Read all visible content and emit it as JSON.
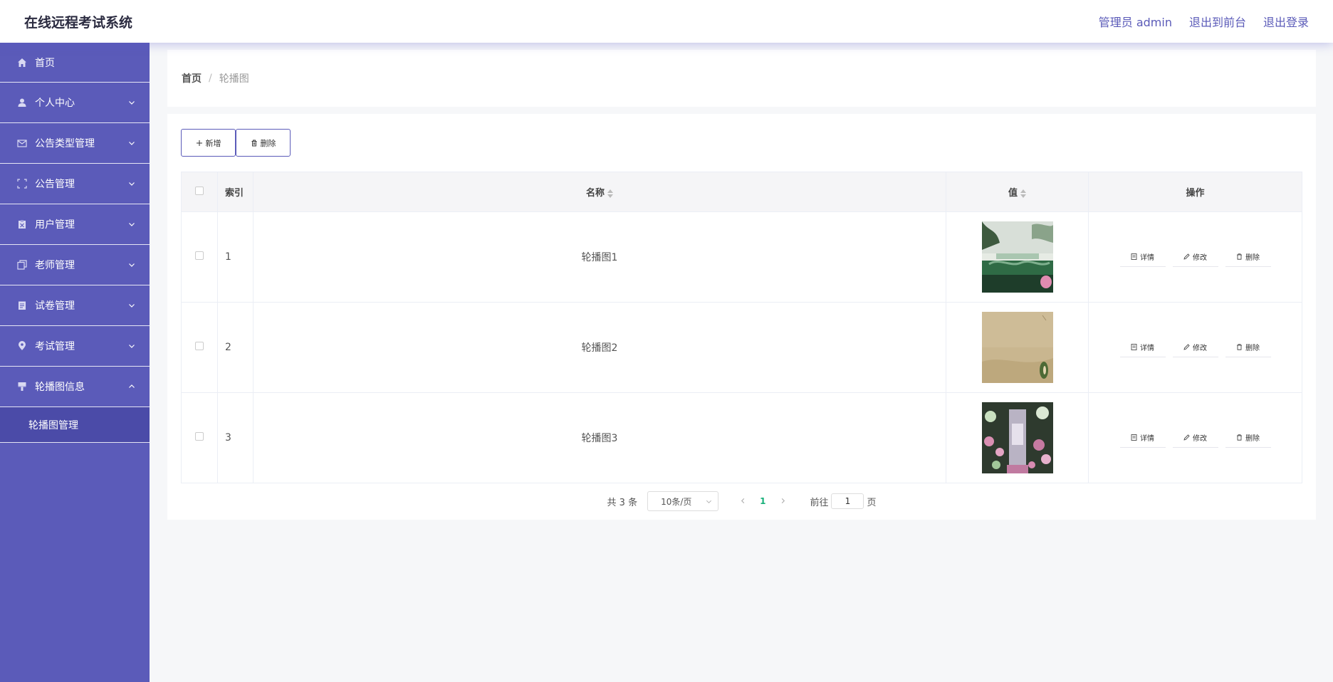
{
  "header": {
    "title": "在线远程考试系统",
    "user_label": "管理员 admin",
    "to_front": "退出到前台",
    "logout": "退出登录"
  },
  "sidebar": {
    "items": [
      {
        "label": "首页",
        "icon": "home-icon"
      },
      {
        "label": "个人中心",
        "icon": "user-icon"
      },
      {
        "label": "公告类型管理",
        "icon": "envelope-icon"
      },
      {
        "label": "公告管理",
        "icon": "fullscreen-icon"
      },
      {
        "label": "用户管理",
        "icon": "clipboard-icon"
      },
      {
        "label": "老师管理",
        "icon": "copy-icon"
      },
      {
        "label": "试卷管理",
        "icon": "document-icon"
      },
      {
        "label": "考试管理",
        "icon": "location-icon"
      },
      {
        "label": "轮播图信息",
        "icon": "brush-icon"
      }
    ],
    "submenu": {
      "label": "轮播图管理"
    }
  },
  "breadcrumb": {
    "home": "首页",
    "separator": "/",
    "current": "轮播图"
  },
  "toolbar": {
    "add_label": "新增",
    "delete_label": "删除"
  },
  "table": {
    "headers": {
      "index": "索引",
      "name": "名称",
      "value": "值",
      "actions": "操作"
    },
    "rows": [
      {
        "index": "1",
        "name": "轮播图1",
        "image": "garden-lake-photo"
      },
      {
        "index": "2",
        "name": "轮播图2",
        "image": "beige-texture-photo"
      },
      {
        "index": "3",
        "name": "轮播图3",
        "image": "flower-alley-photo"
      }
    ],
    "actions": {
      "detail": "详情",
      "edit": "修改",
      "delete": "删除"
    }
  },
  "pagination": {
    "total": "共 3 条",
    "page_size": "10条/页",
    "current_page": "1",
    "goto_prefix": "前往",
    "goto_value": "1",
    "goto_suffix": "页"
  },
  "colors": {
    "sidebar": "#5b5bb9",
    "accent": "#5a5ab8",
    "active_page": "#18b07a"
  }
}
